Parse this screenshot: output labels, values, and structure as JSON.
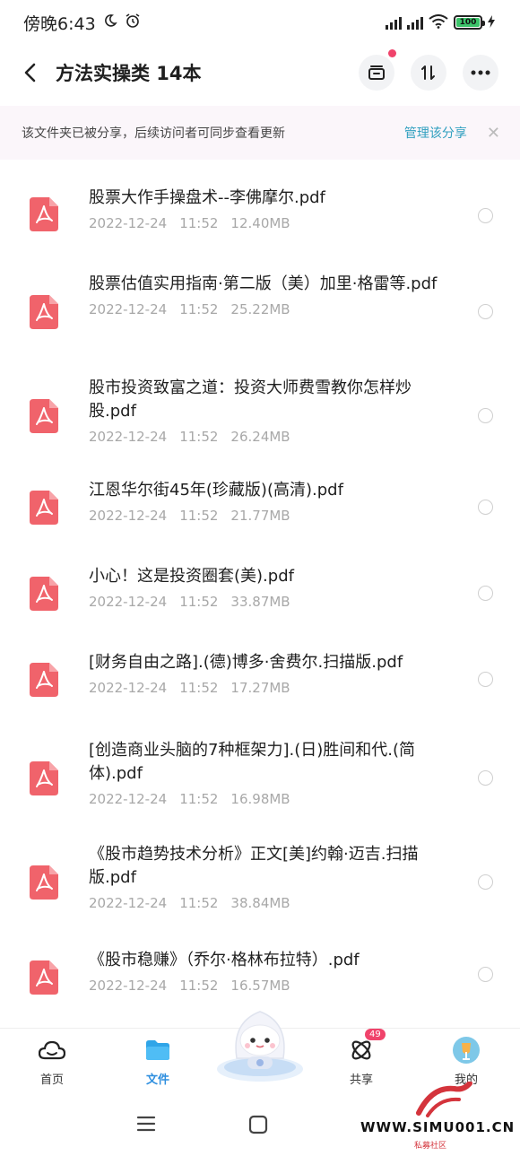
{
  "status_bar": {
    "time": "傍晚6:43",
    "battery": "100"
  },
  "header": {
    "title": "方法实操类 14本"
  },
  "banner": {
    "text": "该文件夹已被分享，后续访问者可同步查看更新",
    "link": "管理该分享"
  },
  "files": [
    {
      "name": "股票大作手操盘术--李佛摩尔.pdf",
      "date": "2022-12-24",
      "time": "11:52",
      "size": "12.40MB"
    },
    {
      "name": "股票估值实用指南·第二版（美）加里·格雷等.pdf",
      "date": "2022-12-24",
      "time": "11:52",
      "size": "25.22MB"
    },
    {
      "name": "股市投资致富之道：投资大师费雪教你怎样炒股.pdf",
      "date": "2022-12-24",
      "time": "11:52",
      "size": "26.24MB"
    },
    {
      "name": "江恩华尔街45年(珍藏版)(高清).pdf",
      "date": "2022-12-24",
      "time": "11:52",
      "size": "21.77MB"
    },
    {
      "name": "小心！这是投资圈套(美).pdf",
      "date": "2022-12-24",
      "time": "11:52",
      "size": "33.87MB"
    },
    {
      "name": "[财务自由之路].(德)博多·舍费尔.扫描版.pdf",
      "date": "2022-12-24",
      "time": "11:52",
      "size": "17.27MB"
    },
    {
      "name": "[创造商业头脑的7种框架力].(日)胜间和代.(简体).pdf",
      "date": "2022-12-24",
      "time": "11:52",
      "size": "16.98MB"
    },
    {
      "name": "《股市趋势技术分析》正文[美]约翰·迈吉.扫描版.pdf",
      "date": "2022-12-24",
      "time": "11:52",
      "size": "38.84MB"
    },
    {
      "name": "《股市稳赚》（乔尔·格林布拉特）.pdf",
      "date": "2022-12-24",
      "time": "11:52",
      "size": "16.57MB"
    }
  ],
  "bottom_nav": {
    "home": "首页",
    "files": "文件",
    "share": "共享",
    "share_badge": "49",
    "mine": "我的"
  },
  "watermark": {
    "text": "WWW.SIMU001.CN",
    "sub": "私募社区"
  },
  "colors": {
    "accent": "#2f8fdf",
    "pdf_icon": "#f0636b",
    "badge": "#f0436b"
  }
}
